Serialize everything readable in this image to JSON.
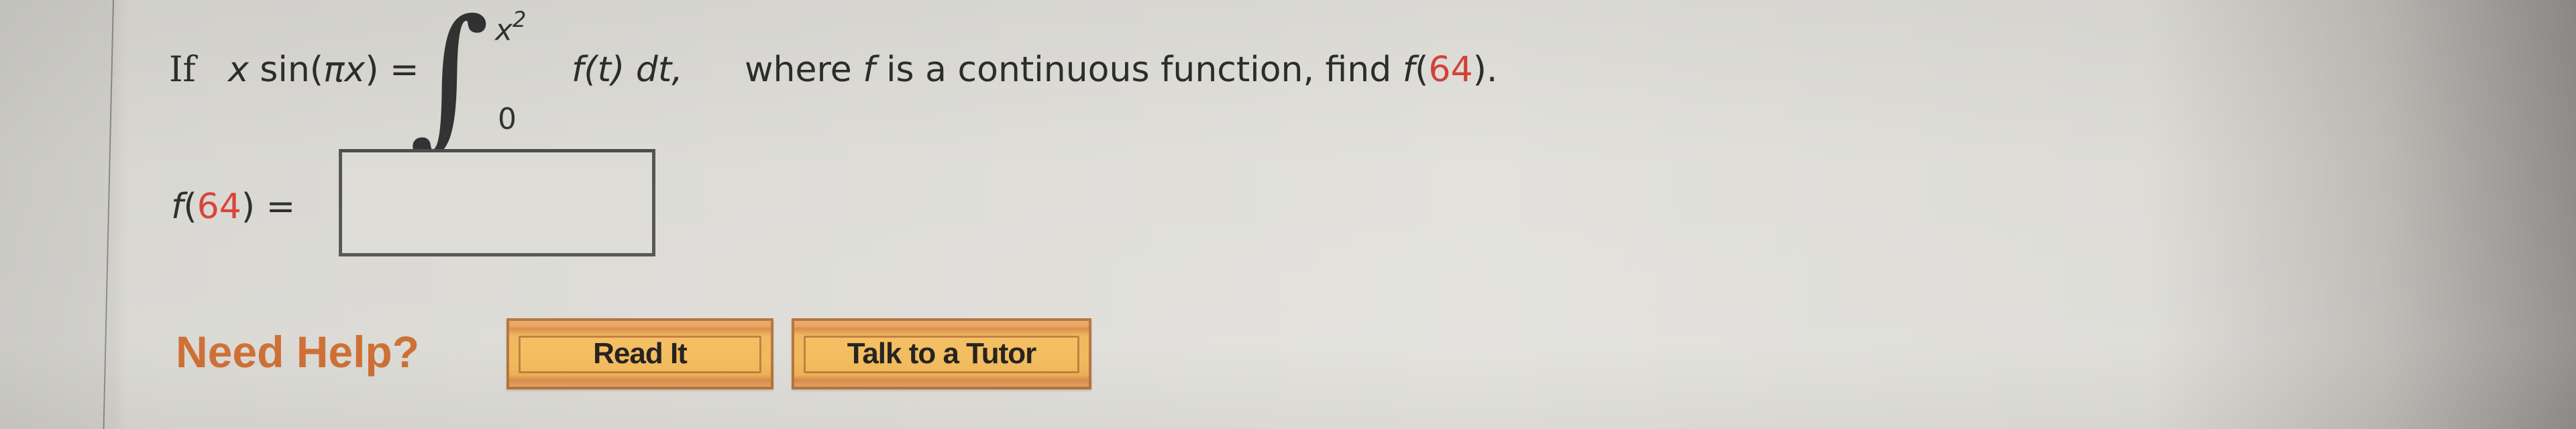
{
  "question": {
    "if_word": "If",
    "lhs": "x sin(πx) =",
    "lhs_parts": {
      "x": "x",
      "sin_open": " sin(",
      "pi_x": "πx",
      "close": ") ="
    },
    "integral_symbol": "∫",
    "upper_limit_base": "x",
    "upper_limit_exp": "2",
    "lower_limit": "0",
    "integrand": "f(t) dt,",
    "integrand_parts": {
      "f": "f",
      "t_paren": "(t)",
      "dt": " dt,"
    },
    "rest_prefix": "where ",
    "rest_f": "f",
    "rest_middle": " is a continuous function, find  ",
    "target_f": "f",
    "target_open": "(",
    "target_value": "64",
    "target_close": ")."
  },
  "answer": {
    "label_f": "f",
    "label_open": "(",
    "label_value": "64",
    "label_close": ") =",
    "input_value": "",
    "input_placeholder": ""
  },
  "help": {
    "title": "Need Help?",
    "buttons": [
      {
        "label": "Read It"
      },
      {
        "label": "Talk to a Tutor"
      }
    ]
  },
  "colors": {
    "highlight_number": "#d9423a",
    "need_help": "#cc6a2c",
    "button_face": "#f2b858",
    "button_border": "#b5703a"
  }
}
